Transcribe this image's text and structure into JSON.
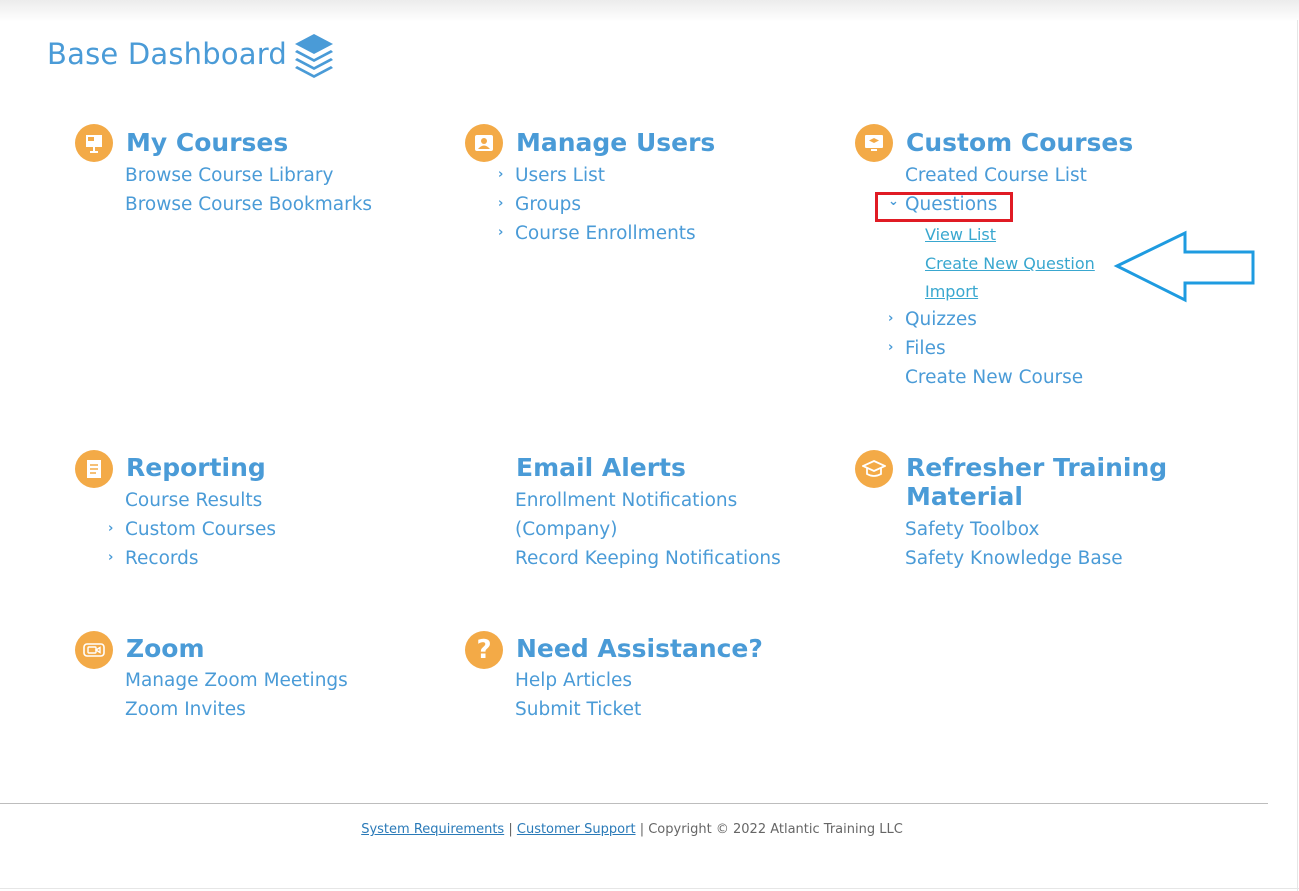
{
  "header": {
    "title": "Base Dashboard",
    "logo_icon": "layers-icon"
  },
  "colors": {
    "accent": "#4a9bd7",
    "icon_bg": "#f3aa47",
    "highlight_box": "#e01b24",
    "arrow": "#1e9be0"
  },
  "my_courses": {
    "title": "My Courses",
    "links": [
      "Browse Course Library",
      "Browse Course Bookmarks"
    ]
  },
  "manage_users": {
    "title": "Manage Users",
    "links": [
      "Users List",
      "Groups",
      "Course Enrollments"
    ]
  },
  "custom_courses": {
    "title": "Custom Courses",
    "created_list": "Created Course List",
    "questions": "Questions",
    "question_sub": [
      "View List",
      "Create New Question",
      "Import"
    ],
    "quizzes": "Quizzes",
    "files": "Files",
    "create_course": "Create New Course"
  },
  "reporting": {
    "title": "Reporting",
    "links": [
      "Course Results",
      "Custom Courses",
      "Records"
    ]
  },
  "email_alerts": {
    "title": "Email Alerts",
    "links": [
      "Enrollment Notifications",
      "(Company)",
      "Record Keeping Notifications"
    ]
  },
  "refresher": {
    "title_line1": "Refresher Training",
    "title_line2": "Material",
    "links": [
      "Safety Toolbox",
      "Safety Knowledge Base"
    ]
  },
  "zoom": {
    "title": "Zoom",
    "links": [
      "Manage Zoom Meetings",
      "Zoom Invites"
    ]
  },
  "assistance": {
    "title": "Need Assistance?",
    "links": [
      "Help Articles",
      "Submit Ticket"
    ]
  },
  "footer": {
    "system_requirements": "System Requirements",
    "separator": "|",
    "customer_support": "Customer Support",
    "copyright": "Copyright © 2022 Atlantic Training LLC"
  }
}
